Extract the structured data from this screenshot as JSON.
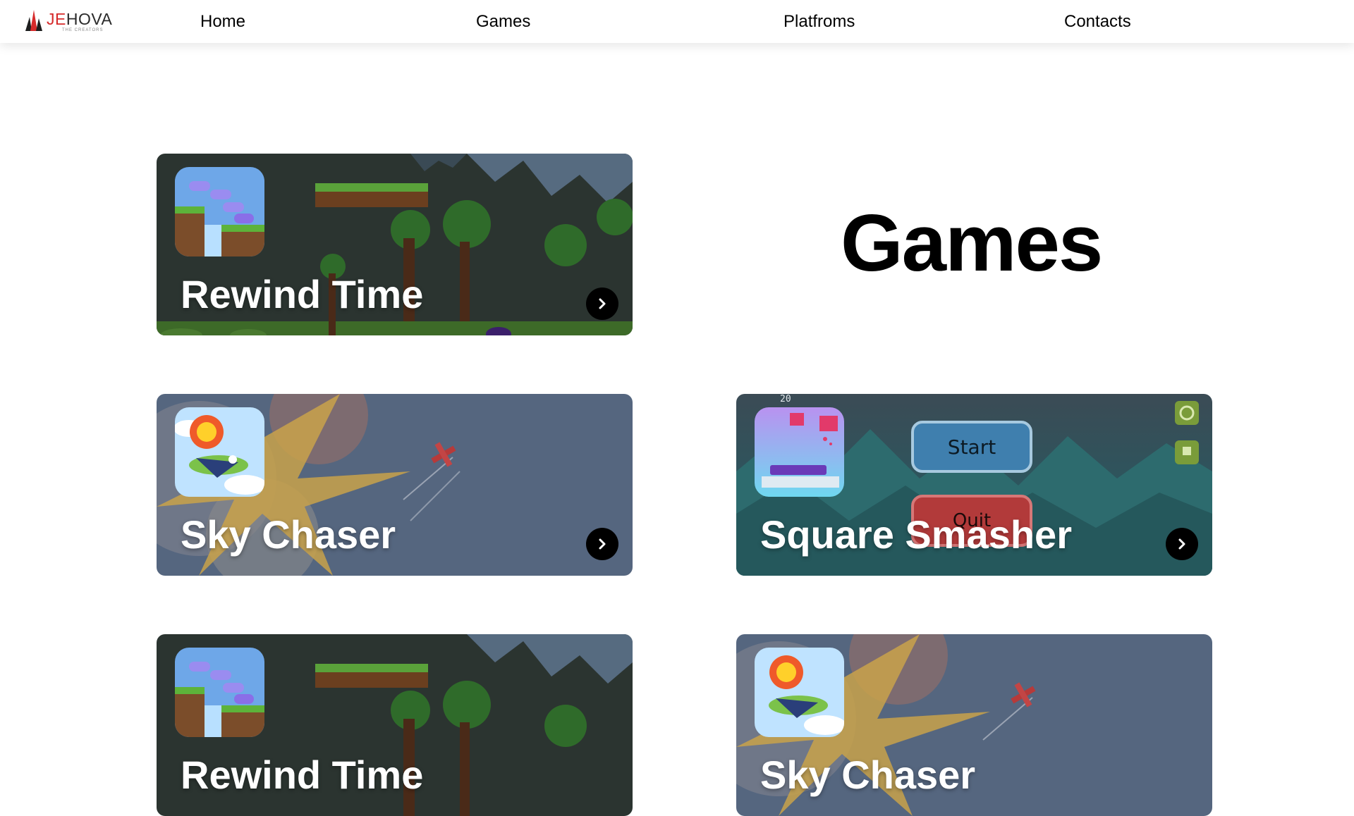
{
  "brand": {
    "name_red": "JE",
    "name_dark": "HOVA",
    "tagline": "THE CREATORS"
  },
  "nav": {
    "links": [
      "Home",
      "Games",
      "Platfroms",
      "Contacts"
    ]
  },
  "page": {
    "heading": "Games"
  },
  "cards": [
    {
      "title": "Rewind Time",
      "theme": "pixel-forest"
    },
    {
      "title": "Sky Chaser",
      "theme": "sky-plane"
    },
    {
      "title": "Square Smasher",
      "theme": "mountains",
      "buttons": [
        "Start",
        "Quit"
      ],
      "score": "20"
    },
    {
      "title": "Rewind Time",
      "theme": "pixel-forest"
    },
    {
      "title": "Sky Chaser",
      "theme": "sky-plane"
    }
  ],
  "colors": {
    "accent_red": "#d62b2b",
    "sky_card": "#55667f",
    "forest_card": "#2b3430",
    "smasher_card": "#2e6f77"
  }
}
